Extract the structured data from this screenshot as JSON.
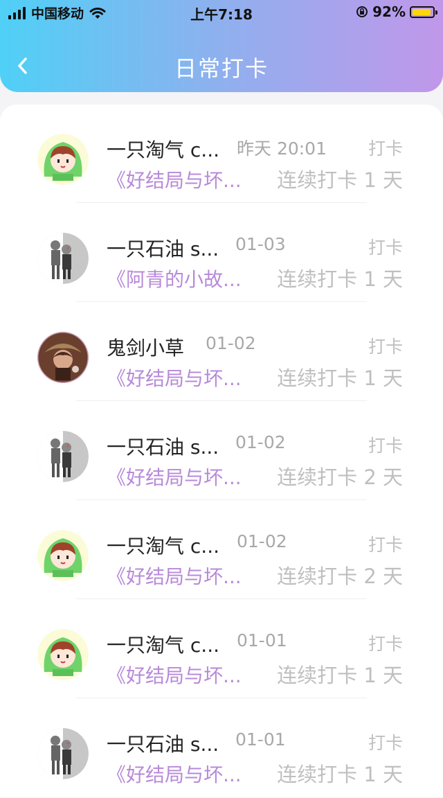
{
  "status": {
    "carrier": "中国移动",
    "time": "上午7:18",
    "battery": "92%",
    "battery_level": 0.92
  },
  "header": {
    "title": "日常打卡",
    "back_icon": "chevron-left-icon"
  },
  "colors": {
    "gradient_start": "#4fd0f6",
    "gradient_end": "#c197ea",
    "book_title": "#b78ad9"
  },
  "entries": [
    {
      "user": "一只淘气 c...",
      "time": "昨天 20:01",
      "action": "打卡",
      "book": "《好结局与坏...",
      "streak": "连续打卡 1 天",
      "avatar": "girl-green-hood-avatar"
    },
    {
      "user": "一只石油 s...",
      "time": "01-03",
      "action": "打卡",
      "book": "《阿青的小故...",
      "streak": "连续打卡 1 天",
      "avatar": "grey-character-avatar"
    },
    {
      "user": "鬼剑小草",
      "time": "01-02",
      "action": "打卡",
      "book": "《好结局与坏...",
      "streak": "连续打卡 1 天",
      "avatar": "brown-character-avatar"
    },
    {
      "user": "一只石油 s...",
      "time": "01-02",
      "action": "打卡",
      "book": "《好结局与坏...",
      "streak": "连续打卡 2 天",
      "avatar": "grey-character-avatar"
    },
    {
      "user": "一只淘气 c...",
      "time": "01-02",
      "action": "打卡",
      "book": "《好结局与坏...",
      "streak": "连续打卡 2 天",
      "avatar": "girl-green-hood-avatar"
    },
    {
      "user": "一只淘气 c...",
      "time": "01-01",
      "action": "打卡",
      "book": "《好结局与坏...",
      "streak": "连续打卡 1 天",
      "avatar": "girl-green-hood-avatar"
    },
    {
      "user": "一只石油 s...",
      "time": "01-01",
      "action": "打卡",
      "book": "《好结局与坏...",
      "streak": "连续打卡 1 天",
      "avatar": "grey-character-avatar"
    }
  ]
}
